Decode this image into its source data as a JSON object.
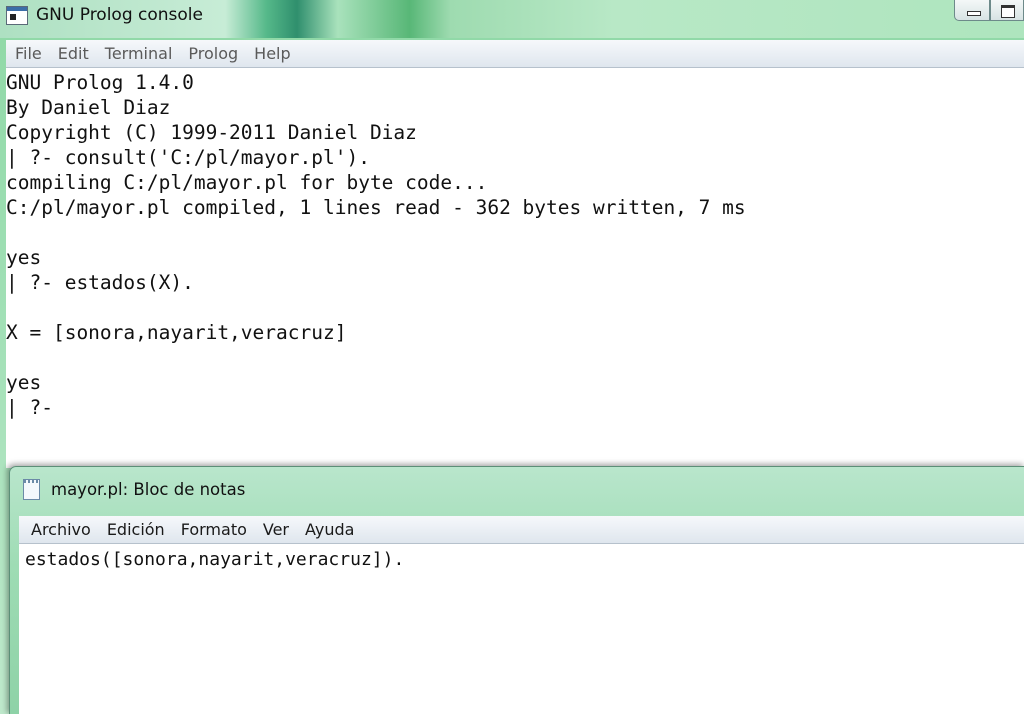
{
  "console": {
    "title": "GNU Prolog console",
    "menu": [
      "File",
      "Edit",
      "Terminal",
      "Prolog",
      "Help"
    ],
    "lines": [
      "GNU Prolog 1.4.0",
      "By Daniel Diaz",
      "Copyright (C) 1999-2011 Daniel Diaz",
      "| ?- consult('C:/pl/mayor.pl').",
      "compiling C:/pl/mayor.pl for byte code...",
      "C:/pl/mayor.pl compiled, 1 lines read - 362 bytes written, 7 ms",
      "",
      "yes",
      "| ?- estados(X).",
      "",
      "X = [sonora,nayarit,veracruz]",
      "",
      "yes",
      "| ?-"
    ]
  },
  "notepad": {
    "title": "mayor.pl: Bloc de notas",
    "menu": [
      "Archivo",
      "Edición",
      "Formato",
      "Ver",
      "Ayuda"
    ],
    "content": "estados([sonora,nayarit,veracruz])."
  }
}
